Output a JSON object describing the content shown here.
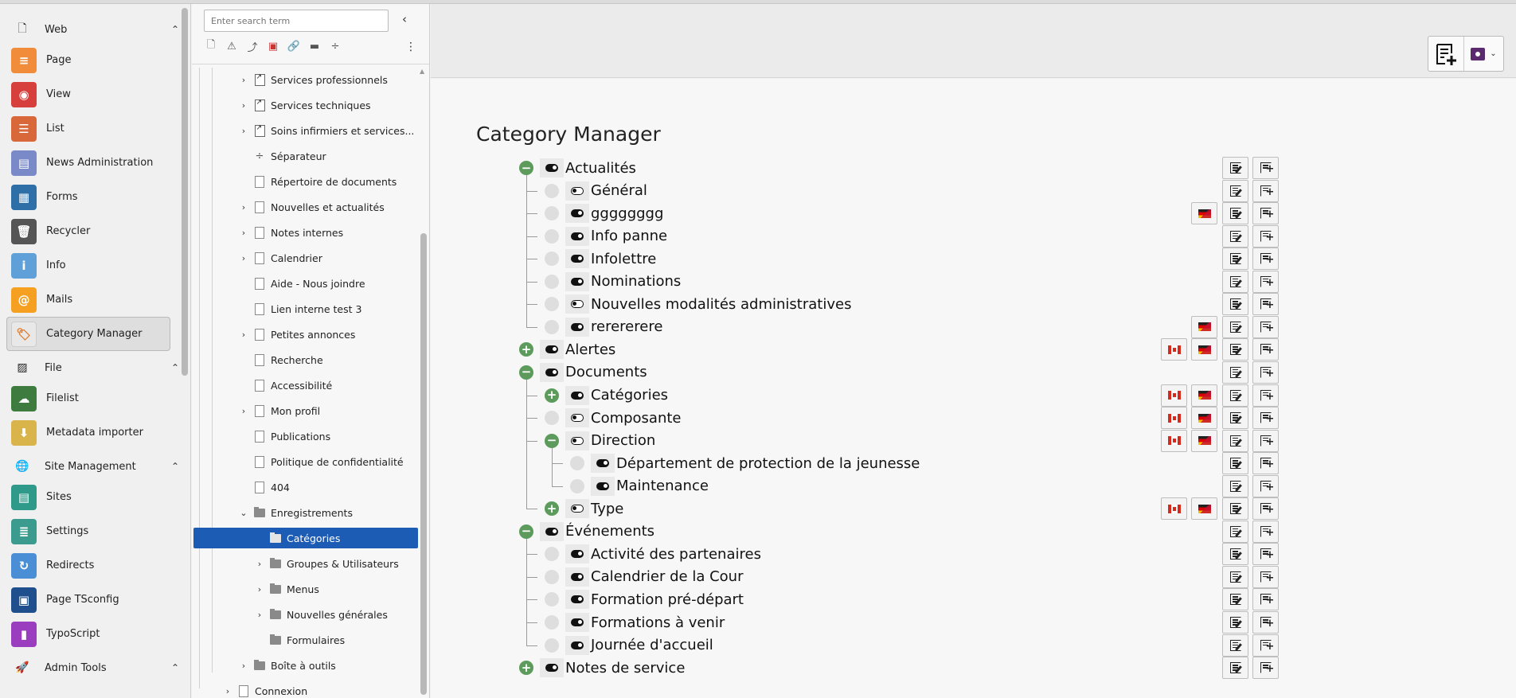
{
  "module_menu": {
    "groups": [
      {
        "label": "Web",
        "icon": "page-icon",
        "modules": [
          {
            "label": "Page",
            "icon": "page-module-icon",
            "color": "#f18d3a",
            "glyph": "≡"
          },
          {
            "label": "View",
            "icon": "eye-icon",
            "color": "#d63f3c",
            "glyph": "◉"
          },
          {
            "label": "List",
            "icon": "list-icon",
            "color": "#d8673a",
            "glyph": "☰"
          },
          {
            "label": "News Administration",
            "icon": "news-icon",
            "color": "#7a89c7",
            "glyph": "▤"
          },
          {
            "label": "Forms",
            "icon": "forms-icon",
            "color": "#2f6fa8",
            "glyph": "▦"
          },
          {
            "label": "Recycler",
            "icon": "trash-icon",
            "color": "#555555",
            "glyph": "🗑"
          },
          {
            "label": "Info",
            "icon": "info-icon",
            "color": "#5fa0d8",
            "glyph": "i"
          },
          {
            "label": "Mails",
            "icon": "mail-icon",
            "color": "#f5a020",
            "glyph": "@"
          },
          {
            "label": "Category Manager",
            "icon": "tag-icon",
            "color": "#e8e8e8",
            "glyph": "🏷",
            "active": true
          }
        ]
      },
      {
        "label": "File",
        "icon": "image-icon",
        "modules": [
          {
            "label": "Filelist",
            "icon": "cloud-icon",
            "color": "#3e7b3e",
            "glyph": "☁"
          },
          {
            "label": "Metadata importer",
            "icon": "import-icon",
            "color": "#d9b44a",
            "glyph": "⬇"
          }
        ]
      },
      {
        "label": "Site Management",
        "icon": "globe-icon",
        "modules": [
          {
            "label": "Sites",
            "icon": "sites-icon",
            "color": "#2f9a8a",
            "glyph": "▤"
          },
          {
            "label": "Settings",
            "icon": "settings-icon",
            "color": "#3a9b8e",
            "glyph": "≣"
          },
          {
            "label": "Redirects",
            "icon": "redirect-icon",
            "color": "#4a8fd6",
            "glyph": "↻"
          },
          {
            "label": "Page TSconfig",
            "icon": "tsconfig-icon",
            "color": "#1f4f8c",
            "glyph": "▣"
          },
          {
            "label": "TypoScript",
            "icon": "typoscript-icon",
            "color": "#9b3dbf",
            "glyph": "▮"
          }
        ]
      },
      {
        "label": "Admin Tools",
        "icon": "rocket-icon",
        "modules": []
      }
    ]
  },
  "page_tree": {
    "search_placeholder": "Enter search term",
    "nodes": [
      {
        "label": "Services professionnels",
        "type": "link",
        "depth": 0,
        "expandable": true
      },
      {
        "label": "Services techniques",
        "type": "link",
        "depth": 0,
        "expandable": true
      },
      {
        "label": "Soins infirmiers et services...",
        "type": "link",
        "depth": 0,
        "expandable": true
      },
      {
        "label": "Séparateur",
        "type": "separator",
        "depth": 0,
        "expandable": false
      },
      {
        "label": "Répertoire de documents",
        "type": "page",
        "depth": 0,
        "expandable": false
      },
      {
        "label": "Nouvelles et actualités",
        "type": "page",
        "depth": 0,
        "expandable": true
      },
      {
        "label": "Notes internes",
        "type": "page",
        "depth": 0,
        "expandable": true
      },
      {
        "label": "Calendrier",
        "type": "page",
        "depth": 0,
        "expandable": true
      },
      {
        "label": "Aide - Nous joindre",
        "type": "page",
        "depth": 0,
        "expandable": false
      },
      {
        "label": "Lien interne test 3",
        "type": "page",
        "depth": 0,
        "expandable": false
      },
      {
        "label": "Petites annonces",
        "type": "page",
        "depth": 0,
        "expandable": true
      },
      {
        "label": "Recherche",
        "type": "page",
        "depth": 0,
        "expandable": false
      },
      {
        "label": "Accessibilité",
        "type": "page",
        "depth": 0,
        "expandable": false
      },
      {
        "label": "Mon profil",
        "type": "page",
        "depth": 0,
        "expandable": true
      },
      {
        "label": "Publications",
        "type": "page",
        "depth": 0,
        "expandable": false
      },
      {
        "label": "Politique de confidentialité",
        "type": "page",
        "depth": 0,
        "expandable": false
      },
      {
        "label": "404",
        "type": "page",
        "depth": 0,
        "expandable": false
      },
      {
        "label": "Enregistrements",
        "type": "folder",
        "depth": 0,
        "expandable": true,
        "expanded": true
      },
      {
        "label": "Catégories",
        "type": "folder",
        "depth": 1,
        "expandable": false,
        "selected": true
      },
      {
        "label": "Groupes & Utilisateurs",
        "type": "folder",
        "depth": 1,
        "expandable": true
      },
      {
        "label": "Menus",
        "type": "folder",
        "depth": 1,
        "expandable": true
      },
      {
        "label": "Nouvelles générales",
        "type": "folder",
        "depth": 1,
        "expandable": true
      },
      {
        "label": "Formulaires",
        "type": "folder",
        "depth": 1,
        "expandable": false
      },
      {
        "label": "Boîte à outils",
        "type": "folder",
        "depth": 0,
        "expandable": true
      },
      {
        "label": "Connexion",
        "type": "page",
        "depth": -1,
        "expandable": true
      }
    ]
  },
  "main": {
    "title": "Category Manager",
    "categories": [
      {
        "label": "Actualités",
        "depth": 0,
        "state": "open",
        "toggle": "on",
        "flags": []
      },
      {
        "label": "Général",
        "depth": 1,
        "state": "leaf",
        "toggle": "off",
        "flags": []
      },
      {
        "label": "gggggggg",
        "depth": 1,
        "state": "leaf",
        "toggle": "on",
        "flags": [
          "mix"
        ]
      },
      {
        "label": "Info panne",
        "depth": 1,
        "state": "leaf",
        "toggle": "on",
        "flags": []
      },
      {
        "label": "Infolettre",
        "depth": 1,
        "state": "leaf",
        "toggle": "on",
        "flags": []
      },
      {
        "label": "Nominations",
        "depth": 1,
        "state": "leaf",
        "toggle": "on",
        "flags": []
      },
      {
        "label": "Nouvelles modalités administratives",
        "depth": 1,
        "state": "leaf",
        "toggle": "off",
        "flags": []
      },
      {
        "label": "rerererere",
        "depth": 1,
        "state": "leaf",
        "toggle": "on",
        "flags": [
          "mix"
        ]
      },
      {
        "label": "Alertes",
        "depth": 0,
        "state": "closed",
        "toggle": "on",
        "flags": [
          "ca",
          "mix"
        ]
      },
      {
        "label": "Documents",
        "depth": 0,
        "state": "open",
        "toggle": "on",
        "flags": []
      },
      {
        "label": "Catégories",
        "depth": 1,
        "state": "closed",
        "toggle": "on",
        "flags": [
          "ca",
          "mix"
        ]
      },
      {
        "label": "Composante",
        "depth": 1,
        "state": "leaf",
        "toggle": "off",
        "flags": [
          "ca",
          "mix"
        ]
      },
      {
        "label": "Direction",
        "depth": 1,
        "state": "open",
        "toggle": "off",
        "flags": [
          "ca",
          "mix"
        ]
      },
      {
        "label": "Département de protection de la jeunesse",
        "depth": 2,
        "state": "leaf",
        "toggle": "on",
        "flags": []
      },
      {
        "label": "Maintenance",
        "depth": 2,
        "state": "leaf",
        "toggle": "on",
        "flags": []
      },
      {
        "label": "Type",
        "depth": 1,
        "state": "closed",
        "toggle": "off",
        "flags": [
          "ca",
          "mix"
        ]
      },
      {
        "label": "Événements",
        "depth": 0,
        "state": "open",
        "toggle": "on",
        "flags": []
      },
      {
        "label": "Activité des partenaires",
        "depth": 1,
        "state": "leaf",
        "toggle": "on",
        "flags": []
      },
      {
        "label": "Calendrier de la Cour",
        "depth": 1,
        "state": "leaf",
        "toggle": "on",
        "flags": []
      },
      {
        "label": "Formation pré-départ",
        "depth": 1,
        "state": "leaf",
        "toggle": "on",
        "flags": []
      },
      {
        "label": "Formations à venir",
        "depth": 1,
        "state": "leaf",
        "toggle": "on",
        "flags": []
      },
      {
        "label": "Journée d'accueil",
        "depth": 1,
        "state": "leaf",
        "toggle": "on",
        "flags": []
      },
      {
        "label": "Notes de service",
        "depth": 0,
        "state": "closed",
        "toggle": "on",
        "flags": []
      }
    ]
  }
}
